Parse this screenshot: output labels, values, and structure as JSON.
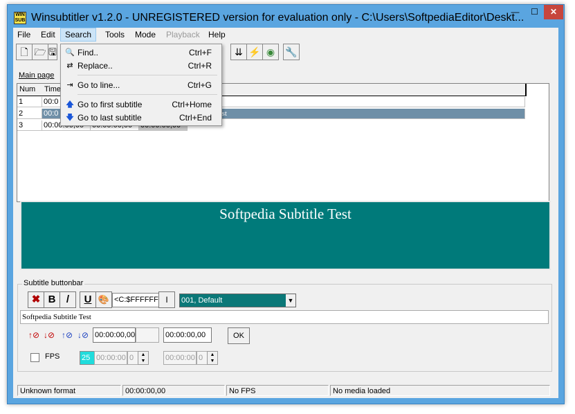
{
  "window": {
    "title": "Winsubtitler v1.2.0 - UNREGISTERED version for evaluation only   - C:\\Users\\SoftpediaEditor\\Deskt...",
    "min_glyph": "—",
    "max_glyph": "☐",
    "close_glyph": "✕",
    "app_icon_text": "WIN SUB"
  },
  "menu": [
    "File",
    "Edit",
    "Search",
    "Tools",
    "Mode",
    "Playback",
    "Help"
  ],
  "toolbar": {
    "icons": [
      "new-file-icon",
      "open-folder-icon",
      "save-icon",
      "download-icon",
      "lightning-icon",
      "cd-icon",
      "settings-icon"
    ],
    "glyphs": [
      "🗋",
      "🗁",
      "🖫",
      "⇊",
      "⚡",
      "◉",
      "🔧"
    ]
  },
  "tab": {
    "main_page": "Main page"
  },
  "grid": {
    "headers": [
      "Num",
      "Time",
      ""
    ],
    "rows": [
      {
        "num": "1",
        "start": "00:0",
        "end": "",
        "dur": "",
        "text": ""
      },
      {
        "num": "2",
        "start": "00:0",
        "end": "",
        "dur": "",
        "text": "Subtitle Test"
      },
      {
        "num": "3",
        "start": "00:00:00,00",
        "end": "00:00:00,00",
        "dur": "00:00:00,00",
        "text": ""
      }
    ]
  },
  "preview": {
    "text": "Softpedia Subtitle Test",
    "bg_color": "#007a7a"
  },
  "buttonbar": {
    "label": "Subtitle buttonbar",
    "bold": "B",
    "italic": "/",
    "underline": "U",
    "color_value": "<C:$FFFFFF>",
    "separator_label": "I",
    "style_value": "001, Default",
    "subtitle_text": "Softpedia Subtitle Test",
    "start_time": "00:00:00,00",
    "end_time": "00:00:00,00",
    "ok_label": "OK",
    "fps_label": "FPS",
    "fps_value": "25",
    "fps_time_1": "00:00:00",
    "fps_frame_1": "0",
    "fps_time_2": "00:00:00",
    "fps_frame_2": "0"
  },
  "status": {
    "format": "Unknown format",
    "time": "00:00:00,00",
    "fps": "No FPS",
    "media": "No media loaded"
  },
  "search_menu": {
    "items": [
      {
        "label": "Find..",
        "shortcut": "Ctrl+F",
        "icon": "find-icon"
      },
      {
        "label": "Replace..",
        "shortcut": "Ctrl+R",
        "icon": "replace-icon"
      },
      {
        "label": "Go to line...",
        "shortcut": "Ctrl+G",
        "icon": "goto-line-icon"
      },
      {
        "label": "Go to first subtitle",
        "shortcut": "Ctrl+Home",
        "icon": "arrow-up-icon"
      },
      {
        "label": "Go to last subtitle",
        "shortcut": "Ctrl+End",
        "icon": "arrow-down-icon"
      }
    ]
  }
}
